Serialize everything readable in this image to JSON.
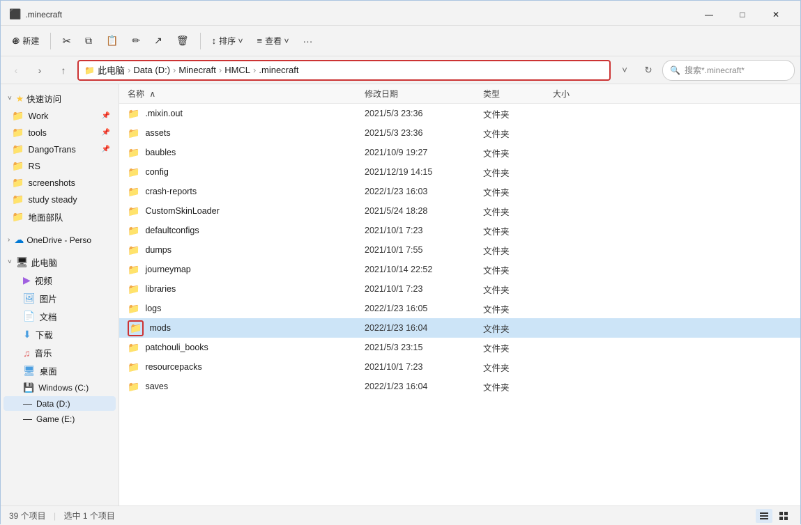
{
  "window": {
    "title": ".minecraft",
    "min_label": "—",
    "max_label": "□",
    "close_label": "✕"
  },
  "toolbar": {
    "new_label": "⊕ 新建",
    "cut_label": "✂",
    "copy_label": "⧉",
    "paste_label": "⬜",
    "rename_label": "⬚",
    "share_label": "⬡",
    "delete_label": "🗑",
    "sort_label": "↕ 排序",
    "view_label": "≡ 查看",
    "more_label": "···"
  },
  "address_bar": {
    "breadcrumbs": [
      "此电脑",
      "Data (D:)",
      "Minecraft",
      "HMCL",
      ".minecraft"
    ],
    "search_placeholder": "搜索*.minecraft*"
  },
  "columns": {
    "name": "名称",
    "date": "修改日期",
    "type": "类型",
    "size": "大小"
  },
  "sidebar": {
    "quick_access_label": "快速访问",
    "items": [
      {
        "name": "Work",
        "pinned": true,
        "type": "folder"
      },
      {
        "name": "tools",
        "pinned": true,
        "type": "folder"
      },
      {
        "name": "DangoTrans",
        "pinned": true,
        "type": "folder"
      },
      {
        "name": "RS",
        "type": "folder"
      },
      {
        "name": "screenshots",
        "type": "folder"
      },
      {
        "name": "study steady",
        "type": "folder"
      },
      {
        "name": "地面部队",
        "type": "folder"
      }
    ],
    "onedrive_label": "OneDrive - Perso",
    "this_pc_label": "此电脑",
    "this_pc_items": [
      {
        "name": "视频",
        "type": "video"
      },
      {
        "name": "图片",
        "type": "picture"
      },
      {
        "name": "文档",
        "type": "doc"
      },
      {
        "name": "下载",
        "type": "download"
      },
      {
        "name": "音乐",
        "type": "music"
      },
      {
        "name": "桌面",
        "type": "desktop"
      }
    ],
    "drives": [
      {
        "name": "Windows (C:)",
        "active": false
      },
      {
        "name": "Data (D:)",
        "active": true
      },
      {
        "name": "Game (E:)"
      }
    ]
  },
  "files": [
    {
      "name": ".mixin.out",
      "date": "2021/5/3 23:36",
      "type": "文件夹",
      "size": ""
    },
    {
      "name": "assets",
      "date": "2021/5/3 23:36",
      "type": "文件夹",
      "size": ""
    },
    {
      "name": "baubles",
      "date": "2021/10/9 19:27",
      "type": "文件夹",
      "size": ""
    },
    {
      "name": "config",
      "date": "2021/12/19 14:15",
      "type": "文件夹",
      "size": ""
    },
    {
      "name": "crash-reports",
      "date": "2022/1/23 16:03",
      "type": "文件夹",
      "size": ""
    },
    {
      "name": "CustomSkinLoader",
      "date": "2021/5/24 18:28",
      "type": "文件夹",
      "size": ""
    },
    {
      "name": "defaultconfigs",
      "date": "2021/10/1 7:23",
      "type": "文件夹",
      "size": ""
    },
    {
      "name": "dumps",
      "date": "2021/10/1 7:55",
      "type": "文件夹",
      "size": ""
    },
    {
      "name": "journeymap",
      "date": "2021/10/14 22:52",
      "type": "文件夹",
      "size": ""
    },
    {
      "name": "libraries",
      "date": "2021/10/1 7:23",
      "type": "文件夹",
      "size": ""
    },
    {
      "name": "logs",
      "date": "2022/1/23 16:05",
      "type": "文件夹",
      "size": ""
    },
    {
      "name": "mods",
      "date": "2022/1/23 16:04",
      "type": "文件夹",
      "size": "",
      "selected": true
    },
    {
      "name": "patchouli_books",
      "date": "2021/5/3 23:15",
      "type": "文件夹",
      "size": ""
    },
    {
      "name": "resourcepacks",
      "date": "2021/10/1 7:23",
      "type": "文件夹",
      "size": ""
    },
    {
      "name": "saves",
      "date": "2022/1/23 16:04",
      "type": "文件夹",
      "size": ""
    }
  ],
  "status": {
    "count_label": "39 个项目",
    "selected_label": "选中 1 个项目"
  }
}
